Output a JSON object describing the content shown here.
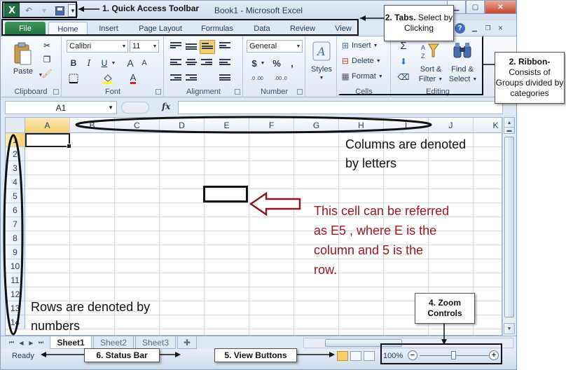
{
  "window": {
    "title": "Book1  -  Microsoft Excel",
    "app_icon": "X",
    "controls": [
      "minimize",
      "maximize",
      "close"
    ]
  },
  "quick_access": {
    "icons": [
      "excel-logo-icon",
      "undo-icon",
      "redo-icon",
      "save-icon",
      "customize-dropdown-icon"
    ]
  },
  "tabs": [
    {
      "label": "File"
    },
    {
      "label": "Home"
    },
    {
      "label": "Insert"
    },
    {
      "label": "Page Layout"
    },
    {
      "label": "Formulas"
    },
    {
      "label": "Data"
    },
    {
      "label": "Review"
    },
    {
      "label": "View"
    }
  ],
  "ribbon": {
    "clipboard": {
      "label": "Clipboard",
      "paste": "Paste"
    },
    "font": {
      "label": "Font",
      "font_name": "Calibri",
      "font_size": "11",
      "bold": "B",
      "italic": "I",
      "underline": "U",
      "font_color_glyph": "A"
    },
    "alignment": {
      "label": "Alignment"
    },
    "number": {
      "label": "Number",
      "format": "General",
      "currency": "$",
      "percent": "%",
      "comma": ",",
      "inc_dec": ".0 .00",
      "dec_dec": ".00 .0"
    },
    "styles": {
      "label": "Styles"
    },
    "cells": {
      "label": "Cells",
      "insert": "Insert",
      "delete": "Delete",
      "format": "Format"
    },
    "editing": {
      "label": "Editing",
      "sort": "Sort &",
      "sort2": "Filter",
      "find": "Find &",
      "find2": "Select",
      "sigma": "Σ"
    }
  },
  "formula_bar": {
    "name_box": "A1",
    "fx": "fx",
    "value": ""
  },
  "grid": {
    "columns": [
      "A",
      "B",
      "C",
      "D",
      "E",
      "F",
      "G",
      "H",
      "I",
      "J",
      "K"
    ],
    "rows": [
      "1",
      "2",
      "3",
      "4",
      "5",
      "6",
      "7",
      "8",
      "9",
      "10",
      "11",
      "12",
      "13",
      "14"
    ],
    "active_cell": "A1"
  },
  "sheets": [
    {
      "label": "Sheet1",
      "active": true
    },
    {
      "label": "Sheet2",
      "active": false
    },
    {
      "label": "Sheet3",
      "active": false
    }
  ],
  "status_bar": {
    "ready": "Ready",
    "zoom": "100%",
    "zoom_minus": "−",
    "zoom_plus": "+",
    "zoom_level_pct": 100
  },
  "annotations": {
    "qat": "1. Quick Access Toolbar",
    "tabs_title": "2. Tabs.",
    "tabs_rest": " Select by Clicking",
    "ribbon_title": "2. Ribbon-",
    "ribbon_rest": "Consists of Groups divided by categories",
    "columns_l1": "Columns are denoted",
    "columns_l2": "by letters",
    "cell_l1": "This cell can be referred",
    "cell_l2": "as E5 , where E is the",
    "cell_l3": "column and 5 is the",
    "cell_l4": "row.",
    "rows_l1": "Rows are denoted by",
    "rows_l2": "numbers",
    "zoom_title": "4. Zoom",
    "zoom_rest": "Controls",
    "status": "6. Status Bar",
    "view": "5. View Buttons"
  },
  "colors": {
    "file_tab": "#1f6e3b",
    "annotation_red": "#a3161c",
    "selected_header": "#f6cf6d"
  }
}
